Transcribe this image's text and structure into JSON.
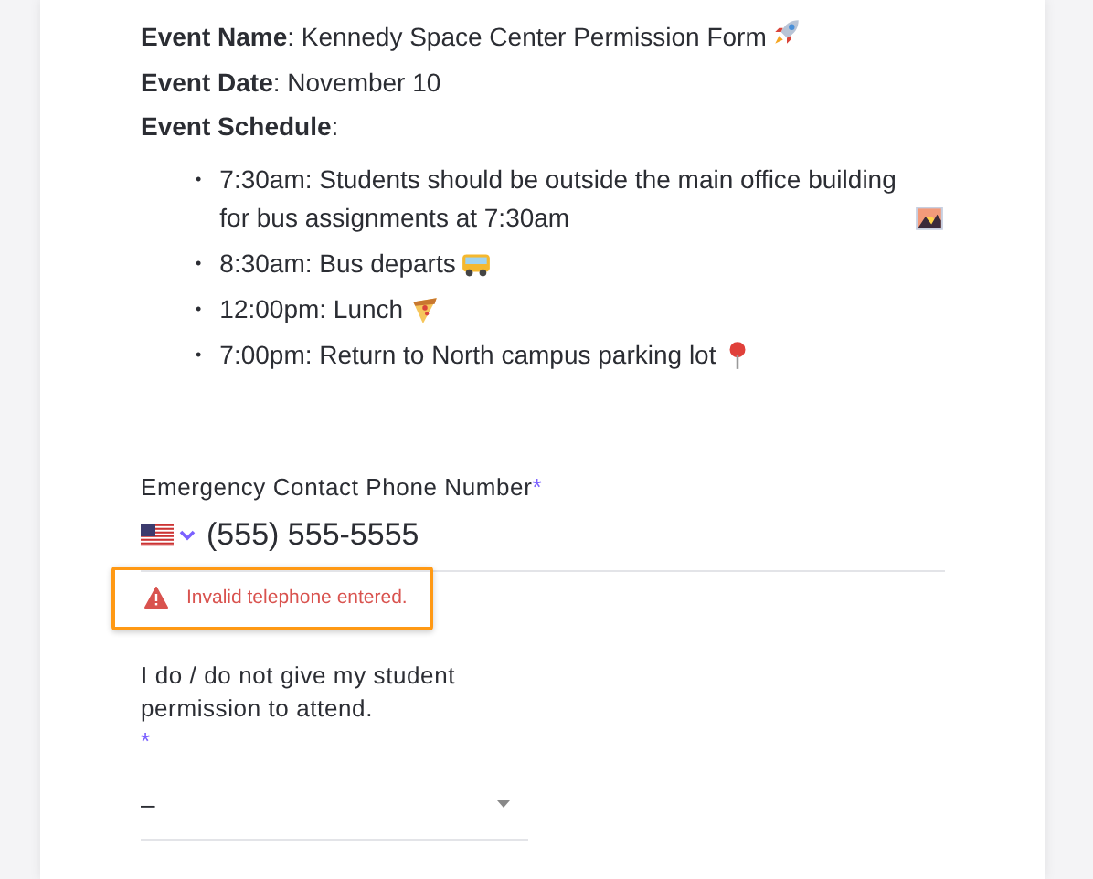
{
  "details": [
    "**Event Name**: Kennedy Space Center Permission Form",
    "**Event Date**: November 10",
    "**Event Schedule**:"
  ],
  "schedule": [
    {
      "marker": "•",
      "text": "7:30am: Students should be outside the main office building for bus assignments at 7:30am"
    },
    {
      "marker": "•",
      "text": "8:30am: Bus departs"
    },
    {
      "marker": "•",
      "text": "12:00pm: Lunch"
    },
    {
      "marker": "•",
      "text": "7:00pm: Return to North campus parking lot"
    }
  ],
  "phone_field": {
    "label": "Emergency Contact Phone Number",
    "required_mark": "*",
    "value": "(555) 555-5555",
    "error": "Invalid telephone entered.",
    "error_highlighted": true
  },
  "permission_field": {
    "label": "I do / do not give my student permission to attend.",
    "required_mark": "*",
    "value": "–"
  }
}
